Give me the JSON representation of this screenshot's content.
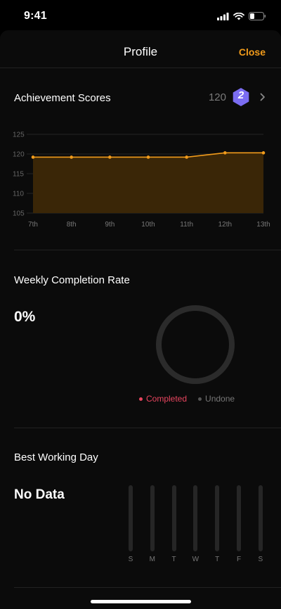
{
  "status_bar": {
    "time": "9:41"
  },
  "nav": {
    "title": "Profile",
    "close_label": "Close"
  },
  "achievement": {
    "title": "Achievement Scores",
    "score": "120",
    "level_badge": "2"
  },
  "chart_data": {
    "type": "area",
    "categories": [
      "7th",
      "8th",
      "9th",
      "10th",
      "11th",
      "12th",
      "13th"
    ],
    "series": [
      {
        "values": [
          119.2,
          119.2,
          119.2,
          119.2,
          119.2,
          120.3,
          120.3
        ]
      }
    ],
    "y_ticks": [
      "125",
      "120",
      "115",
      "110",
      "105"
    ],
    "ylim": [
      105,
      125
    ],
    "grid": true,
    "line_color": "#f19b1b",
    "fill_color": "#3a2607"
  },
  "weekly": {
    "title": "Weekly Completion Rate",
    "rate": "0%",
    "completed_fraction": 0,
    "legend_completed": "Completed",
    "legend_undone": "Undone",
    "completed_color": "#e8455f",
    "undone_color": "#555555"
  },
  "best_day": {
    "title": "Best Working Day",
    "value": "No Data",
    "days": [
      "S",
      "M",
      "T",
      "W",
      "T",
      "F",
      "S"
    ]
  },
  "colors": {
    "accent": "#f19b1b",
    "badge": "#7b6df2"
  }
}
